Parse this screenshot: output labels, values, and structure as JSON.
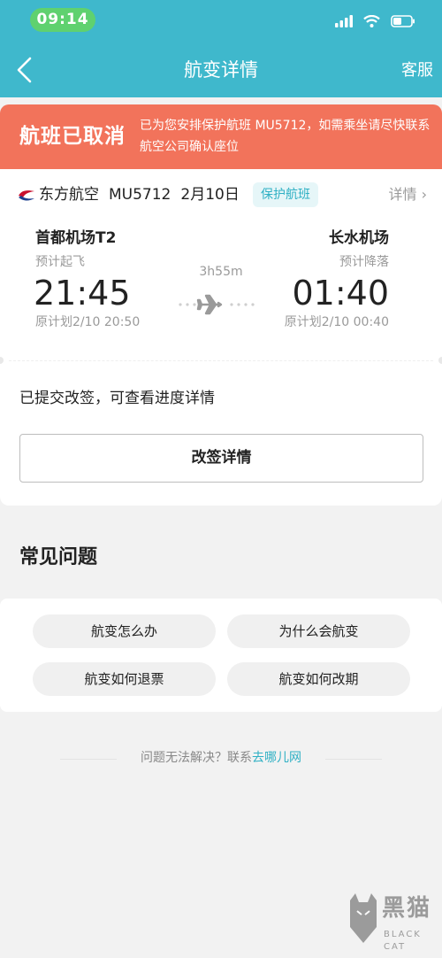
{
  "status_bar": {
    "time": "09:14"
  },
  "nav": {
    "title": "航变详情",
    "service_label": "客服"
  },
  "cancel_banner": {
    "title": "航班已取消",
    "message": "已为您安排保护航班 MU5712，如需乘坐请尽快联系航空公司确认座位"
  },
  "flight": {
    "airline": "东方航空",
    "flight_no": "MU5712",
    "date": "2月10日",
    "badge": "保护航班",
    "detail_label": "详情 ›",
    "departure": {
      "airport": "首都机场T2",
      "label": "预计起飞",
      "time": "21:45",
      "original": "原计划2/10 20:50"
    },
    "arrival": {
      "airport": "长水机场",
      "label": "预计降落",
      "time": "01:40",
      "original": "原计划2/10 00:40"
    },
    "duration": "3h55m"
  },
  "change": {
    "note": "已提交改签，可查看进度详情",
    "button_label": "改签详情"
  },
  "faq": {
    "title": "常见问题",
    "items": [
      "航变怎么办",
      "为什么会航变",
      "航变如何退票",
      "航变如何改期"
    ]
  },
  "help": {
    "text": "问题无法解决？联系",
    "brand": "去哪儿网"
  },
  "watermark": {
    "text": "黑猫",
    "sub": "BLACK CAT"
  },
  "colors": {
    "header": "#3fb8cc",
    "banner": "#f2735b",
    "accent": "#2fb0c4"
  }
}
